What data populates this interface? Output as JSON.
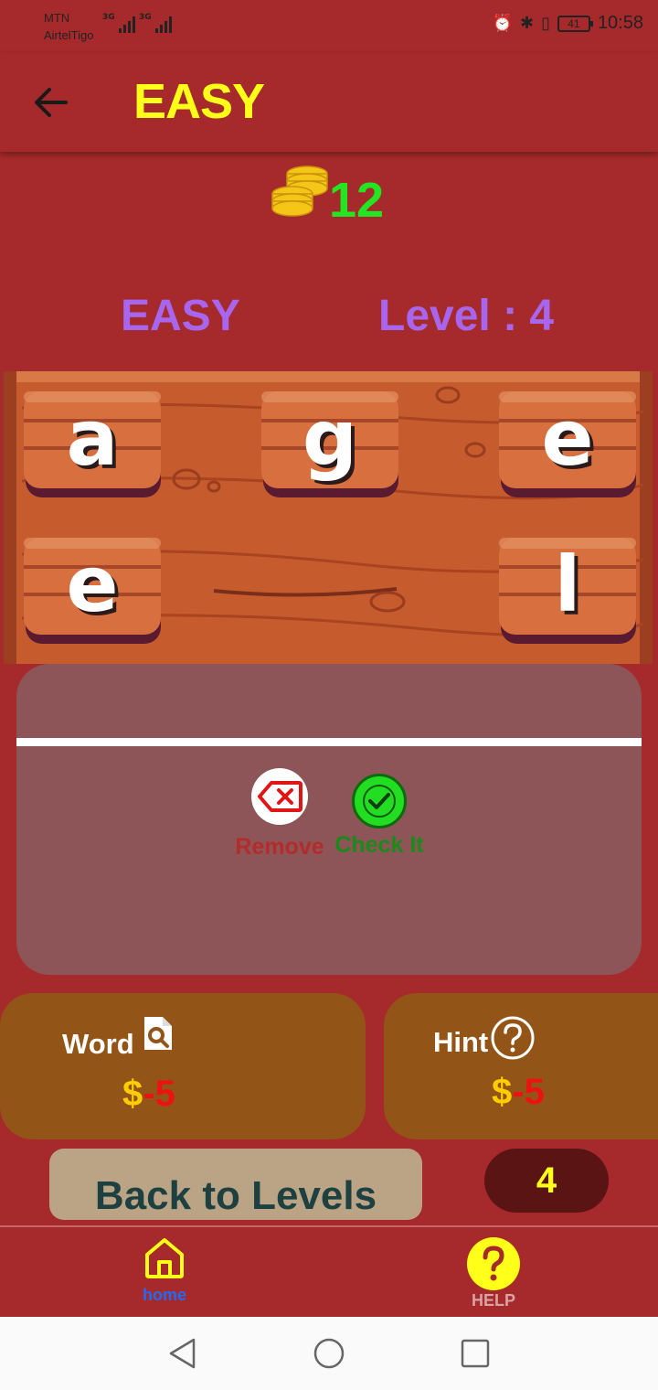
{
  "status_bar": {
    "carrier_1": "MTN",
    "carrier_2": "AirtelTigo",
    "network_1": "3G",
    "network_2": "3G",
    "battery": "41",
    "time": "10:58"
  },
  "app_bar": {
    "title": "EASY"
  },
  "coins": {
    "count": "12"
  },
  "game": {
    "difficulty": "EASY",
    "level_text": "Level : 4",
    "letters": [
      "a",
      "g",
      "e",
      "e",
      "l"
    ]
  },
  "actions": {
    "remove_label": "Remove",
    "check_label": "Check It"
  },
  "powerups": {
    "word_label": "Word",
    "word_currency": "$",
    "word_cost": "-5",
    "hint_label": "Hint",
    "hint_currency": "$",
    "hint_cost": "-5"
  },
  "footer": {
    "back_label": "Back to Levels",
    "level_number": "4"
  },
  "bottom_nav": {
    "home_label": "home",
    "help_label": "HELP"
  },
  "colors": {
    "background": "#a62a2b",
    "title_yellow": "#ffff1a",
    "coin_green": "#22e622",
    "purple": "#a865ee",
    "remove_red": "#b52b2b",
    "check_green": "#1a8a1a",
    "home_blue": "#1e6bff"
  }
}
